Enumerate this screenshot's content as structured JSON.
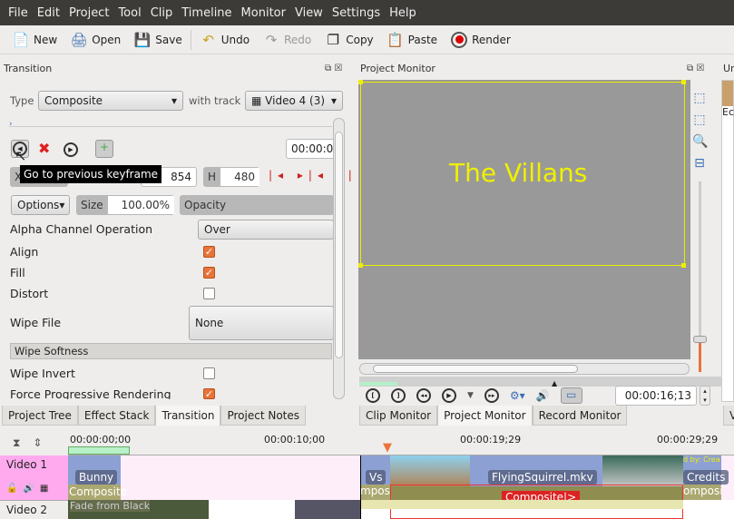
{
  "menu": [
    "File",
    "Edit",
    "Project",
    "Tool",
    "Clip",
    "Timeline",
    "Monitor",
    "View",
    "Settings",
    "Help"
  ],
  "toolbar": {
    "new": "New",
    "open": "Open",
    "save": "Save",
    "undo": "Undo",
    "redo": "Redo",
    "copy": "Copy",
    "paste": "Paste",
    "render": "Render"
  },
  "transition": {
    "title": "Transition",
    "type_label": "Type",
    "type_value": "Composite",
    "with_track_label": "with track",
    "track_value": "Video 4 (3)",
    "timecode": "00:00:0",
    "tooltip": "Go to previous keyframe",
    "x_label": "X",
    "w_value": "854",
    "h_label": "H",
    "h_value": "480",
    "options": "Options",
    "size_label": "Size",
    "size_value": "100.00%",
    "opacity_label": "Opacity",
    "alpha_label": "Alpha Channel Operation",
    "alpha_value": "Over",
    "align": "Align",
    "fill": "Fill",
    "distort": "Distort",
    "wipe_file": "Wipe File",
    "wipe_file_value": "None",
    "wipe_softness": "Wipe Softness",
    "wipe_invert": "Wipe Invert",
    "force_prog": "Force Progressive Rendering",
    "align_checked": true,
    "fill_checked": true,
    "distort_checked": false,
    "wipe_invert_checked": false,
    "force_prog_checked": true
  },
  "left_tabs": [
    "Project Tree",
    "Effect Stack",
    "Transition",
    "Project Notes"
  ],
  "monitor": {
    "title": "Project Monitor",
    "overlay_text": "The Villans",
    "timecode": "00:00:16;13"
  },
  "monitor_tabs": [
    "Clip Monitor",
    "Project Monitor",
    "Record Monitor"
  ],
  "right_panel": {
    "title": "Ur",
    "item": "Ec",
    "tab": "V"
  },
  "timeline": {
    "ruler": [
      "00:00:00;00",
      "00:00:10;00",
      "00:00:19;29",
      "00:00:29;29"
    ],
    "tracks": [
      "Video 1",
      "Video 2"
    ],
    "clips": {
      "bunny": "Bunny",
      "composite1": "Composite",
      "vs": "Vs",
      "mpos": "mpos",
      "flying": "FlyingSquirrel.mkv",
      "composite_sel": "Composite|>",
      "credits": "Credits",
      "composit2": "omposit",
      "fade": "Fade from Black",
      "credit_text": "d by: Crea"
    }
  },
  "colors": {
    "accent": "#e8743b",
    "overlay_text": "#f0f000",
    "track_header": "#ffaaee",
    "selected_composite": "#dd2222"
  }
}
